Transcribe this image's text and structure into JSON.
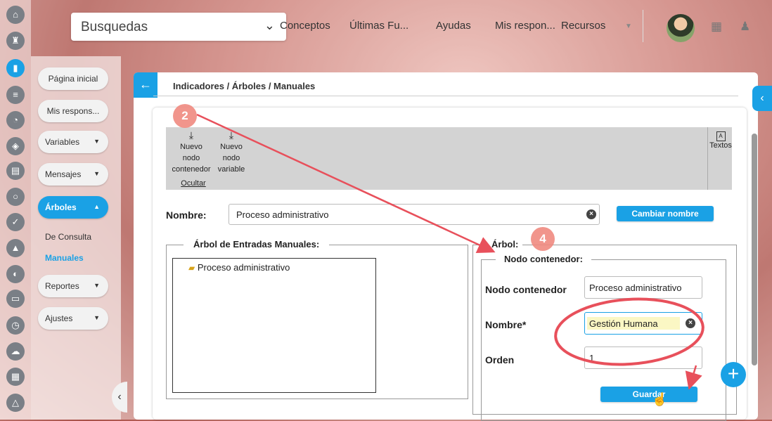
{
  "topbar": {
    "search_label": "Busquedas",
    "nav": [
      "Conceptos",
      "Últimas Fu...",
      "Ayudas",
      "Mis respon...",
      "Recursos"
    ]
  },
  "sidemenu": {
    "pagina_inicial": "Página inicial",
    "mis_respons": "Mis respons...",
    "variables": "Variables",
    "mensajes": "Mensajes",
    "arboles": "Árboles",
    "de_consulta": "De Consulta",
    "manuales": "Manuales",
    "reportes": "Reportes",
    "ajustes": "Ajustes"
  },
  "breadcrumb": "Indicadores / Árboles / Manuales",
  "toolbar": {
    "nuevo_contenedor": [
      "Nuevo",
      "nodo",
      "contenedor"
    ],
    "nuevo_variable": [
      "Nuevo",
      "nodo",
      "variable"
    ],
    "ocultar": "Ocultar",
    "textos": "Textos",
    "textos_icon": "A"
  },
  "nombre": {
    "label": "Nombre:",
    "value": "Proceso administrativo",
    "cambiar_label": "Cambiar nombre"
  },
  "arbol_entradas": {
    "legend": "Árbol de Entradas Manuales:",
    "item": "Proceso administrativo"
  },
  "arbol": {
    "legend": "Árbol:",
    "sub_legend": "Nodo contenedor:",
    "nodo_contenedor_label": "Nodo contenedor",
    "nodo_contenedor_value": "Proceso administrativo",
    "nombre_label": "Nombre*",
    "nombre_value": "Gestión Humana",
    "orden_label": "Orden",
    "orden_value": "1",
    "guardar": "Guardar"
  },
  "annotations": {
    "step_a": "2",
    "step_b": "4"
  },
  "colors": {
    "accent": "#1aa1e5",
    "annotation": "#e8505b"
  }
}
